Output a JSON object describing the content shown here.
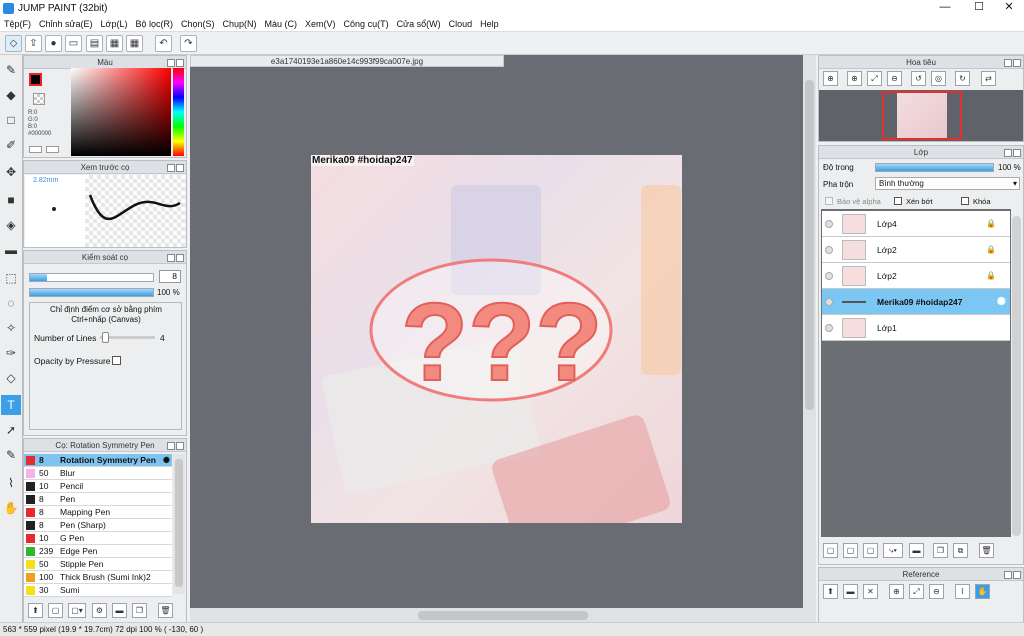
{
  "window": {
    "title": "JUMP PAINT (32bit)",
    "min": "—",
    "max": "☐",
    "close": "✕"
  },
  "menu": [
    "Tệp(F)",
    "Chỉnh sửa(E)",
    "Lớp(L)",
    "Bộ lọc(R)",
    "Chọn(S)",
    "Chụp(N)",
    "Màu (C)",
    "Xem(V)",
    "Công cụ(T)",
    "Cửa sổ(W)",
    "Cloud",
    "Help"
  ],
  "document": {
    "filename": "e3a1740193e1a860e14c993f99ca007e.jpg",
    "watermark": "Merika09 #hoidap247"
  },
  "color_panel": {
    "title": "Màu",
    "r": "R:0",
    "g": "G:0",
    "b": "B:0",
    "hex": "#000000"
  },
  "brush_preview": {
    "title": "Xem trước cọ",
    "size": "2.82mm"
  },
  "brush_control": {
    "title": "Kiểm soát cọ",
    "size_value": "8",
    "opacity_value": "100 %",
    "hint": "Chỉ định điểm cơ sở bằng phím Ctrl+nhấp (Canvas)",
    "lines_label": "Number of Lines",
    "lines_value": "4",
    "opacity_pressure": "Opacity by Pressure"
  },
  "brush_list": {
    "title": "Cọ: Rotation Symmetry Pen",
    "items": [
      {
        "size": "8",
        "name": "Rotation Symmetry Pen",
        "color": "#e52b2b"
      },
      {
        "size": "50",
        "name": "Blur",
        "color": "#f5b3e8"
      },
      {
        "size": "10",
        "name": "Pencil",
        "color": "#222222"
      },
      {
        "size": "8",
        "name": "Pen",
        "color": "#222222"
      },
      {
        "size": "8",
        "name": "Mapping Pen",
        "color": "#e52b2b"
      },
      {
        "size": "8",
        "name": "Pen (Sharp)",
        "color": "#222222"
      },
      {
        "size": "10",
        "name": "G Pen",
        "color": "#e52b2b"
      },
      {
        "size": "239",
        "name": "Edge Pen",
        "color": "#2fb52f"
      },
      {
        "size": "50",
        "name": "Stipple Pen",
        "color": "#f2e21c"
      },
      {
        "size": "100",
        "name": "Thick Brush (Sumi Ink)2",
        "color": "#f2a01c"
      },
      {
        "size": "30",
        "name": "Sumi",
        "color": "#f2e21c"
      }
    ]
  },
  "navigator": {
    "title": "Hoa tiêu"
  },
  "layer_panel": {
    "title": "Lớp",
    "opacity_label": "Độ trong",
    "opacity_value": "100 %",
    "blend_label": "Pha trộn",
    "blend_value": "Bình thường",
    "protect_alpha": "Bảo vệ alpha",
    "clip": "Xén bớt",
    "lock": "Khóa",
    "layers": [
      {
        "name": "Lớp4",
        "selected": false
      },
      {
        "name": "Lớp2",
        "selected": false
      },
      {
        "name": "Lớp2",
        "selected": false
      },
      {
        "name": "Merika09 #hoidap247",
        "selected": true
      },
      {
        "name": "Lớp1",
        "selected": false
      }
    ]
  },
  "reference": {
    "title": "Reference"
  },
  "status": {
    "text": "563 * 559 pixel   (19.9 * 19.7cm)   72 dpi   100 %   ( -130, 60 )"
  }
}
